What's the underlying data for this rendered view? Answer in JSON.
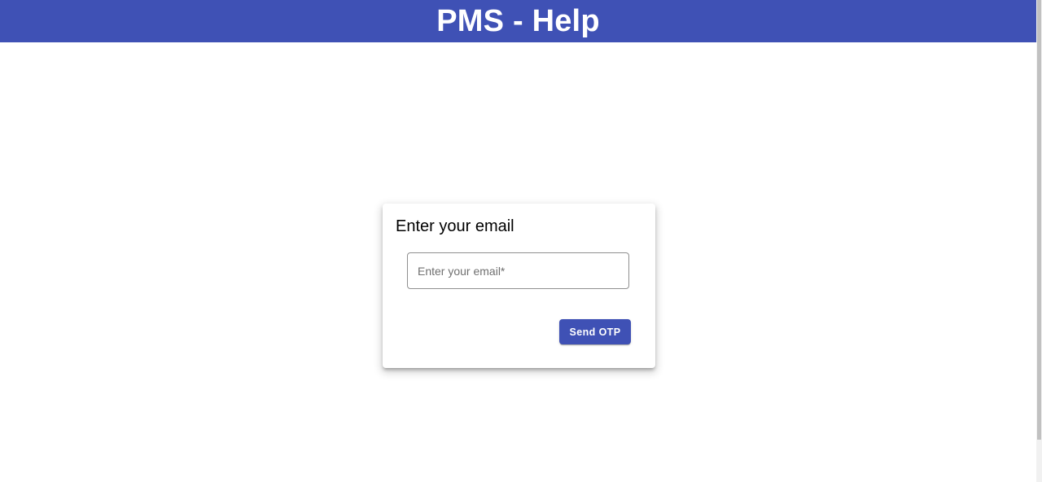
{
  "header": {
    "title": "PMS - Help"
  },
  "card": {
    "title": "Enter your email",
    "email_field": {
      "value": "",
      "placeholder": "Enter your email*"
    },
    "send_button_label": "Send OTP"
  },
  "colors": {
    "primary": "#3f51b5",
    "background": "#ffffff",
    "header_text": "#ffffff"
  }
}
